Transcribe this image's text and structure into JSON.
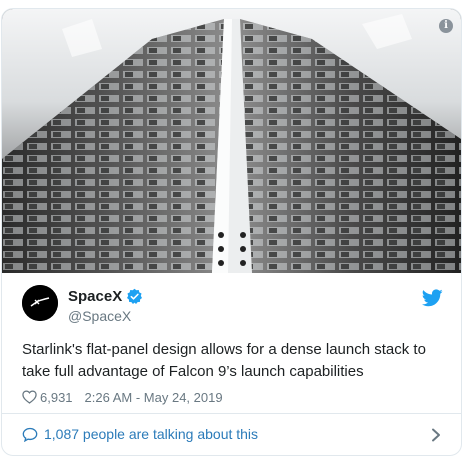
{
  "tweet": {
    "author_name": "SpaceX",
    "author_handle": "@SpaceX",
    "text": "Starlink's flat-panel design allows for a dense launch stack to take full advantage of Falcon 9’s launch capabilities",
    "likes": "6,931",
    "timestamp": "2:26 AM - May 24, 2019",
    "verified": true
  },
  "footer": {
    "talking_label": "1,087 people are talking about this"
  },
  "media": {
    "info_label": "i",
    "subject": "stack of Starlink satellites"
  },
  "colors": {
    "link": "#2b7bb9",
    "twitter_blue": "#1da1f2",
    "muted": "#697882",
    "text": "#1c2022",
    "border": "#e1e8ed"
  },
  "icons": [
    "info-icon",
    "verified-badge-icon",
    "twitter-bird-icon",
    "heart-icon",
    "speech-bubble-icon",
    "chevron-right-icon"
  ]
}
